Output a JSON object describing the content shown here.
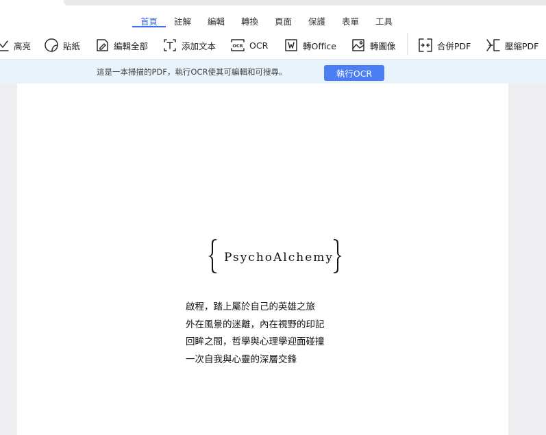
{
  "menu": {
    "tabs": [
      {
        "label": "首頁",
        "active": true
      },
      {
        "label": "註解"
      },
      {
        "label": "編輯"
      },
      {
        "label": "轉換"
      },
      {
        "label": "頁面"
      },
      {
        "label": "保護"
      },
      {
        "label": "表單"
      },
      {
        "label": "工具"
      }
    ]
  },
  "toolbar": {
    "highlight": "高亮",
    "sticker": "貼紙",
    "edit_all": "編輯全部",
    "add_text": "添加文本",
    "ocr": "OCR",
    "to_office": "轉Office",
    "to_image": "轉圖像",
    "merge_pdf": "合併PDF",
    "compress_pdf": "壓縮PDF",
    "ocr_icon_text": "OCR"
  },
  "banner": {
    "message": "這是一本掃描的PDF，執行OCR使其可編輯和可搜尋。",
    "button": "執行OCR"
  },
  "document": {
    "brand": "PsychoAlchemy",
    "lines": [
      "啟程，踏上屬於自己的英雄之旅",
      "外在風景的迷離，內在視野的印記",
      "回眸之間，哲學與心理學迎面碰撞",
      "一次自我與心靈的深層交鋒"
    ]
  },
  "colors": {
    "accent": "#3c6ef0",
    "banner_bg": "#e9f3fc",
    "button_bg": "#4b7ef2",
    "workspace_bg": "#eeeef0"
  }
}
